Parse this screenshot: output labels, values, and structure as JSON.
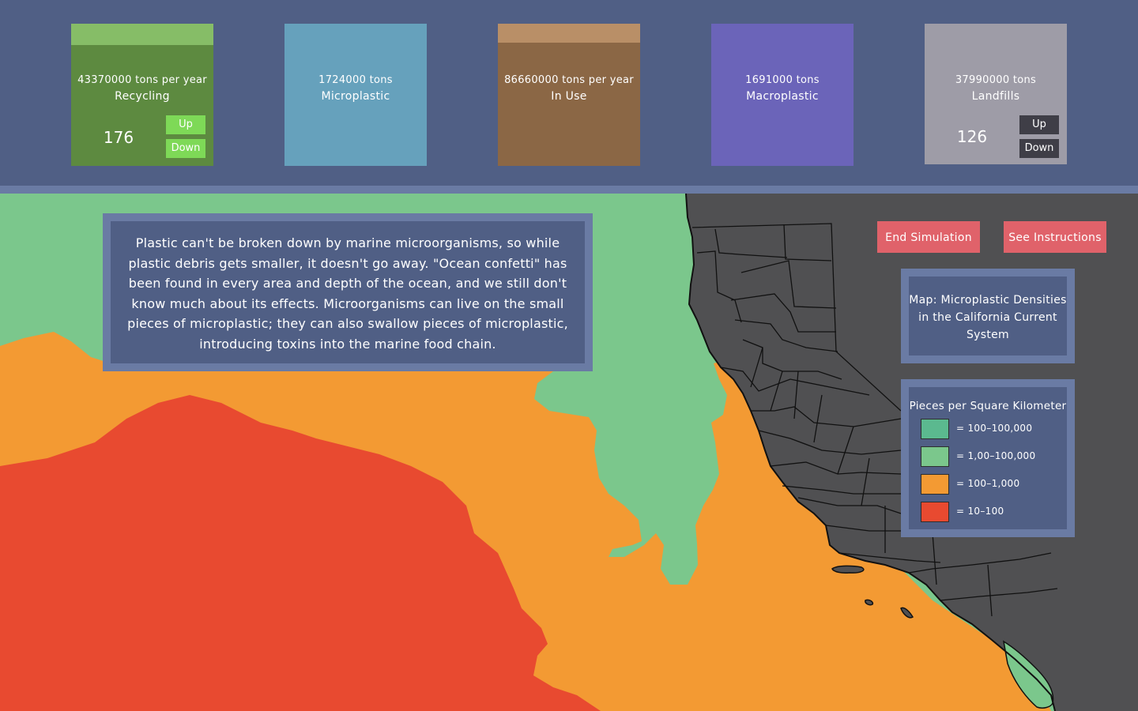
{
  "cards": {
    "recycling": {
      "line1": "43370000 tons per year",
      "line2": "Recycling",
      "count": "176",
      "up_label": "Up",
      "down_label": "Down",
      "color": "#5d8a40"
    },
    "microplastic": {
      "line1": "1724000 tons",
      "line2": "Microplastic",
      "color": "#66a1bc"
    },
    "in_use": {
      "line1": "86660000 tons per year",
      "line2": "In Use",
      "color": "#8b6745"
    },
    "macroplastic": {
      "line1": "1691000 tons",
      "line2": "Macroplastic",
      "color": "#6b64b9"
    },
    "landfills": {
      "line1": "37990000 tons",
      "line2": "Landfills",
      "count": "126",
      "up_label": "Up",
      "down_label": "Down",
      "color": "#9e9ca7"
    }
  },
  "info_text": "Plastic can't be broken down by marine microorganisms, so while plastic debris gets smaller, it doesn't go away. \"Ocean confetti\" has been found in every area and depth of the ocean, and we still don't know much about its effects. Microorganisms can live on the small pieces of microplastic; they can also swallow pieces of microplastic, introducing toxins into the marine food chain.",
  "buttons": {
    "end_simulation": "End Simulation",
    "see_instructions": "See Instructions"
  },
  "map_title": "Map: Microplastic Densities in the California Current System",
  "legend": {
    "title": "Pieces per Square Kilometer",
    "items": [
      {
        "color": "#5bb98f",
        "label": "= 100–100,000"
      },
      {
        "color": "#7bc78c",
        "label": "= 1,00–100,000"
      },
      {
        "color": "#f39a33",
        "label": "= 100–1,000"
      },
      {
        "color": "#e84a30",
        "label": "= 10–100"
      }
    ]
  },
  "colors": {
    "header_bg": "#505f85",
    "border": "#6a7ba4",
    "land": "#505052",
    "green": "#7bc78c",
    "orange": "#f39a33",
    "red": "#e84a30"
  }
}
